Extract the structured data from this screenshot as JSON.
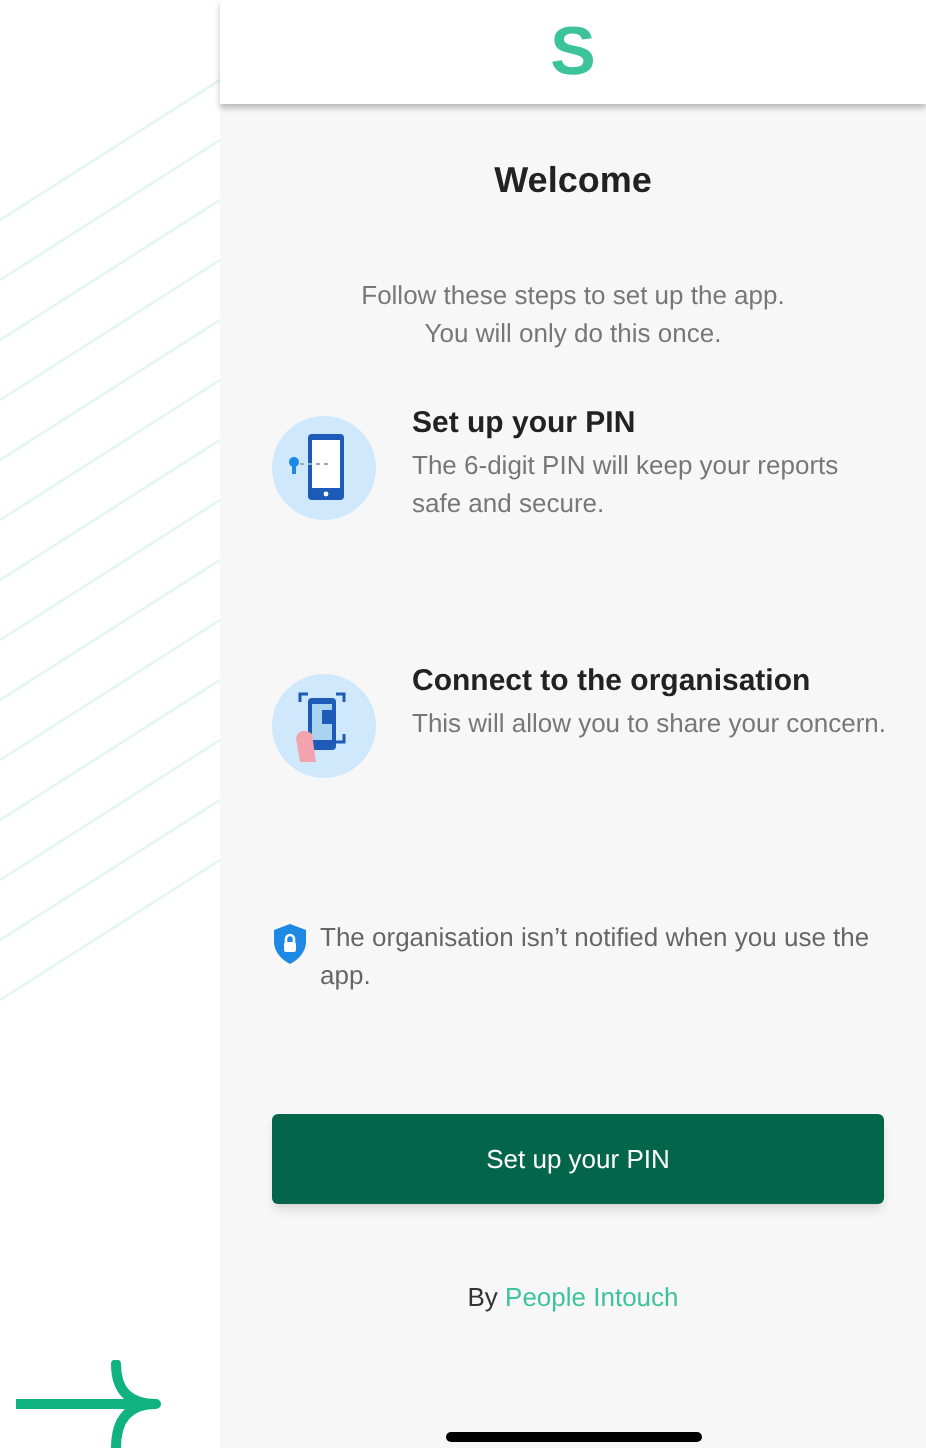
{
  "header": {
    "logo": "S"
  },
  "title": "Welcome",
  "intro": [
    "Follow these steps to set up the app.",
    "You will only do this once."
  ],
  "steps": [
    {
      "kind": "pin",
      "title": "Set up your PIN",
      "description": "The 6-digit PIN will keep your reports safe and secure."
    },
    {
      "kind": "connect",
      "title": "Connect to the organisation",
      "description": "This will allow you to share your concern."
    }
  ],
  "note": "The organisation isn’t notified when you use the app.",
  "button": "Set up your PIN",
  "footer": {
    "prefix": "By",
    "link": "People Intouch"
  }
}
